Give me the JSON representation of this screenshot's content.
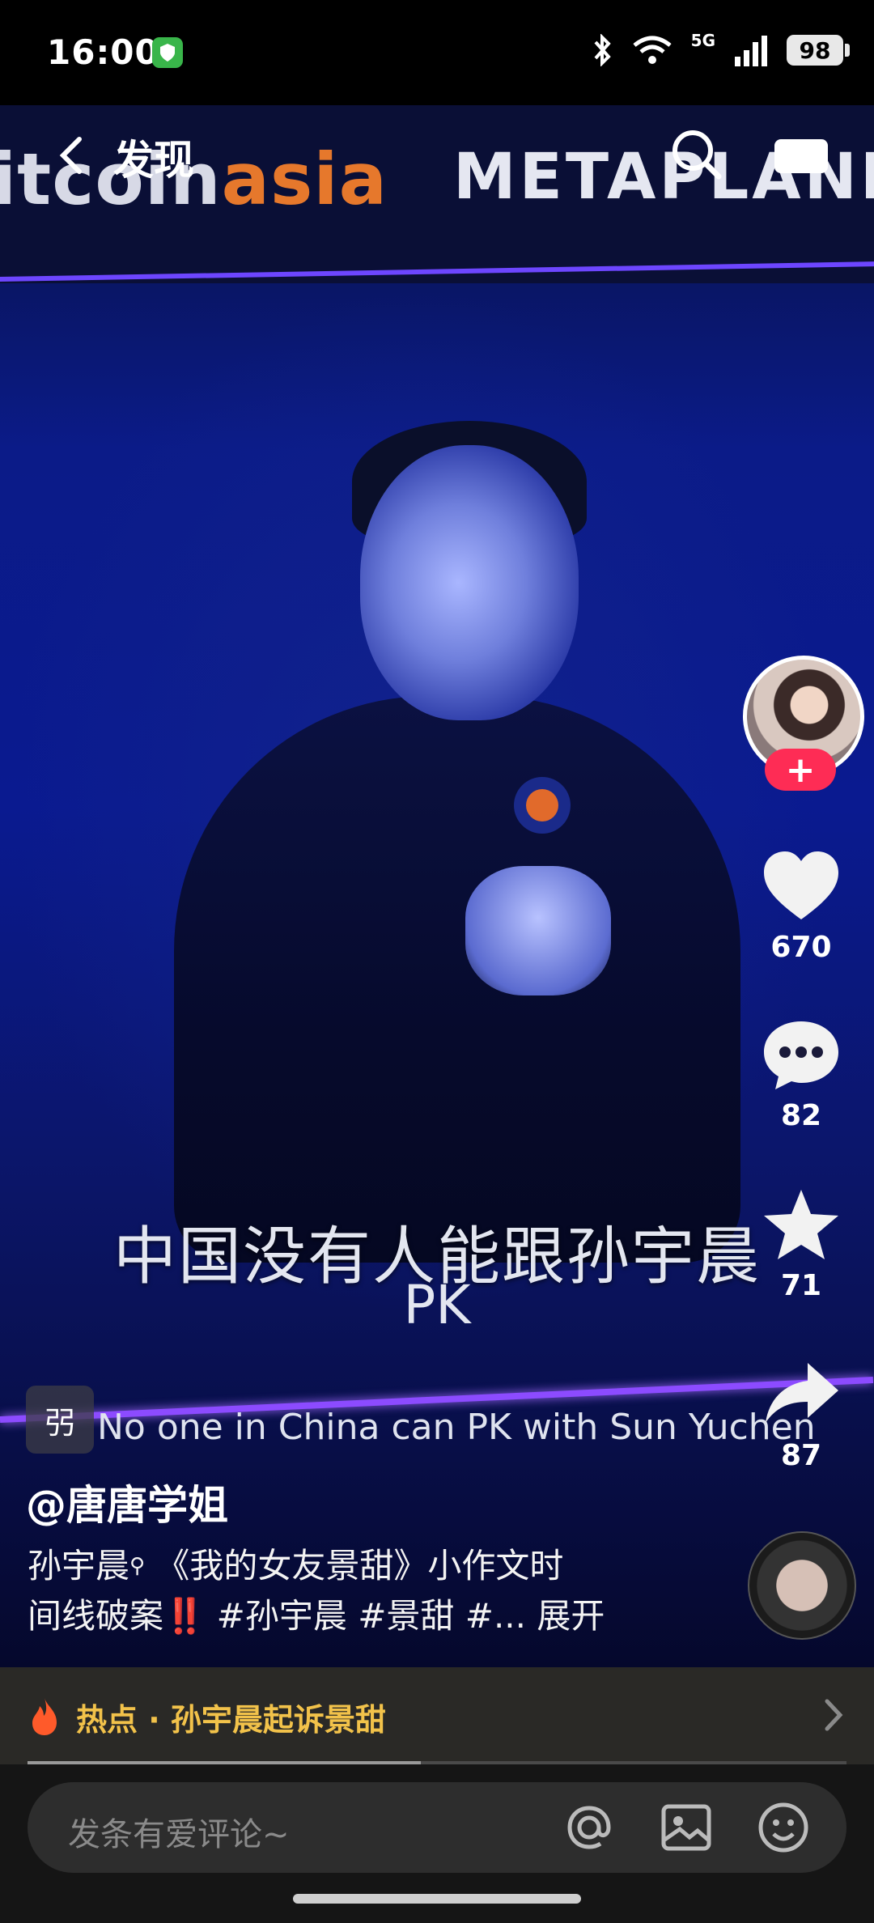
{
  "status_bar": {
    "time": "16:00",
    "network": "5G",
    "battery": "98",
    "icons": [
      "shield-icon",
      "bluetooth-icon",
      "wifi-icon",
      "signal-icon"
    ]
  },
  "nav": {
    "title": "发现",
    "back_icon": "chevron-left-icon",
    "search_icon": "search-icon",
    "camera_icon": "camera-icon"
  },
  "video": {
    "banner_left_prefix": "itcoin",
    "banner_left_suffix": "asia",
    "banner_right": "METAPLANET",
    "caption_zh": "中国没有人能跟孙宇晨",
    "caption_pk": "PK",
    "caption_en": "No one in China can PK with Sun Yuchen"
  },
  "rail": {
    "likes": "670",
    "comments": "82",
    "favorites": "71",
    "shares": "87",
    "follow_symbol": "+"
  },
  "post": {
    "chip_glyph": "弜",
    "username": "@唐唐学姐",
    "desc_line1": "孙宇晨",
    "desc_line1_rest": "《我的女友景甜》小作文时",
    "desc_line2_a": "间线破案",
    "desc_line2_emoji": "‼️",
    "desc_line2_b": " #孙宇晨 #景甜 #... ",
    "expand": "展开"
  },
  "hot": {
    "text": "热点 · 孙宇晨起诉景甜",
    "progress": 0.48
  },
  "comment_bar": {
    "placeholder": "发条有爱评论~"
  },
  "colors": {
    "accent_red": "#fe2c55",
    "hot_yellow": "#f2c24a"
  }
}
